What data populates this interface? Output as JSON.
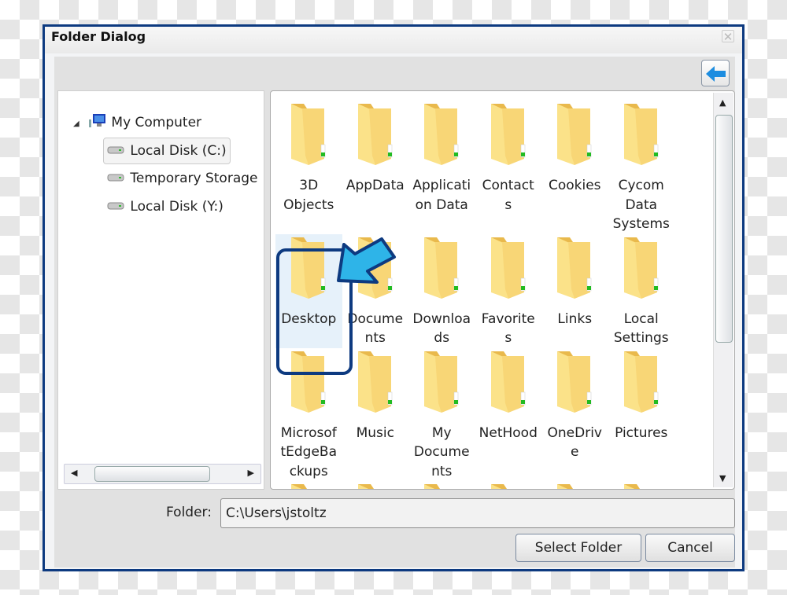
{
  "dialog": {
    "title": "Folder Dialog",
    "close_icon": "close-icon",
    "back_icon": "back-arrow-icon"
  },
  "tree": {
    "root": "My Computer",
    "drives": [
      {
        "label": "Local Disk (C:)",
        "selected": true
      },
      {
        "label": "Temporary Storage"
      },
      {
        "label": "Local Disk (Y:)"
      }
    ]
  },
  "folders": [
    "3D Objects",
    "AppData",
    "Application Data",
    "Contacts",
    "Cookies",
    "Cycom Data Systems",
    "Desktop",
    "Documents",
    "Downloads",
    "Favorites",
    "Links",
    "Local Settings",
    "MicrosoftEdgeBackups",
    "Music",
    "My Documents",
    "NetHood",
    "OneDrive",
    "Pictures"
  ],
  "folder_display": [
    "3D\nObjects",
    "AppData",
    "Applicati\non Data",
    "Contact\ns",
    "Cookies",
    "Cycom\nData\nSystems",
    "Desktop",
    "Docume\nnts",
    "Downloa\nds",
    "Favorite\ns",
    "Links",
    "Local\nSettings",
    "Microsof\ntEdgeBa\nckups",
    "Music",
    "My\nDocume\nnts",
    "NetHood",
    "OneDriv\ne",
    "Pictures"
  ],
  "selected_folder": "Desktop",
  "footer": {
    "folder_label": "Folder:",
    "folder_value": "C:\\Users\\jstoltz",
    "select_button": "Select Folder",
    "cancel_button": "Cancel"
  },
  "colors": {
    "frame": "#0d3a80",
    "callout_arrow": "#2eb4e8",
    "folder": "#f8d676"
  }
}
